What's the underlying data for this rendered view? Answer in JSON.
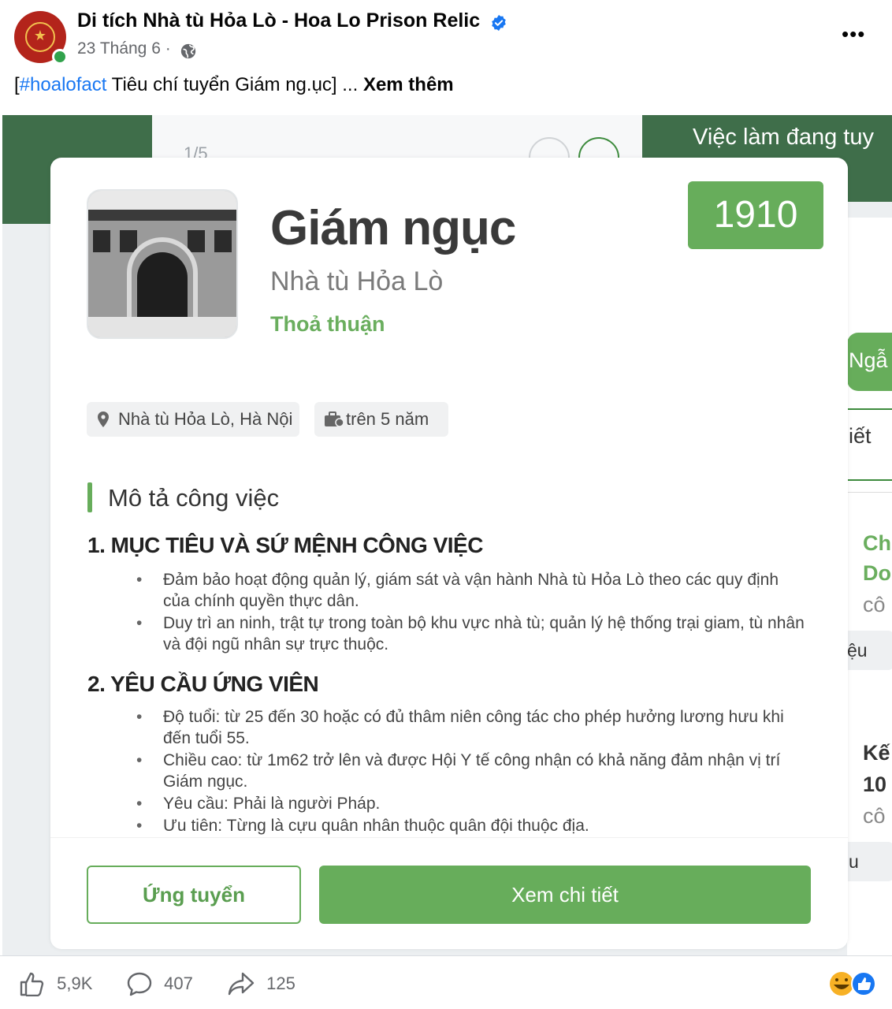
{
  "post": {
    "page_name": "Di tích Nhà tù Hỏa Lò - Hoa Lo Prison Relic",
    "date": "23 Tháng 6",
    "date_sep": "·",
    "hashtag": "#hoalofact",
    "text": " Tiêu chí tuyển Giám ng.ục] ... ",
    "bracket_open": "[",
    "see_more": "Xem thêm",
    "more_menu": "•••"
  },
  "background_card": {
    "pager": "1/5",
    "right_title": "Việc làm đang tuy",
    "right_button": "Ngẫ",
    "right_tab": "iết",
    "right_lines": [
      "Ch",
      "Do",
      "cô",
      "ệu",
      "Kế",
      "10",
      "cô",
      "u"
    ]
  },
  "job": {
    "title": "Giám ngục",
    "company": "Nhà tù Hỏa Lò",
    "salary": "Thoả thuận",
    "year": "1910",
    "location": "Nhà tù Hỏa Lò, Hà Nội",
    "experience": "trên 5 năm",
    "section_title": "Mô tả công việc",
    "heading1": "1. MỤC TIÊU VÀ SỨ MỆNH CÔNG VIỆC",
    "bullets1": [
      "Đảm bảo hoạt động quản lý, giám sát và vận hành Nhà tù Hỏa Lò theo các quy định của chính quyền thực dân.",
      "Duy trì an ninh, trật tự trong toàn bộ khu vực nhà tù; quản lý hệ thống trại giam, tù nhân và đội ngũ nhân sự trực thuộc."
    ],
    "heading2": "2. YÊU CẦU ỨNG VIÊN",
    "bullets2": [
      "Độ tuổi: từ 25 đến 30 hoặc có đủ thâm niên công tác cho phép hưởng lương hưu khi đến tuổi 55.",
      "Chiều cao: từ 1m62 trở lên và được Hội Y tế công nhận có khả năng đảm nhận vị trí Giám ngục.",
      "Yêu cầu: Phải là người Pháp.",
      "Ưu tiên: Từng là cựu quân nhân thuộc quân đội thuộc địa."
    ],
    "apply_label": "Ứng tuyển",
    "detail_label": "Xem chi tiết"
  },
  "footer": {
    "likes": "5,9K",
    "comments": "407",
    "shares": "125"
  },
  "colors": {
    "accent_green": "#67ad5b",
    "dark_green": "#3f6e4a",
    "link_blue": "#1877f2"
  }
}
